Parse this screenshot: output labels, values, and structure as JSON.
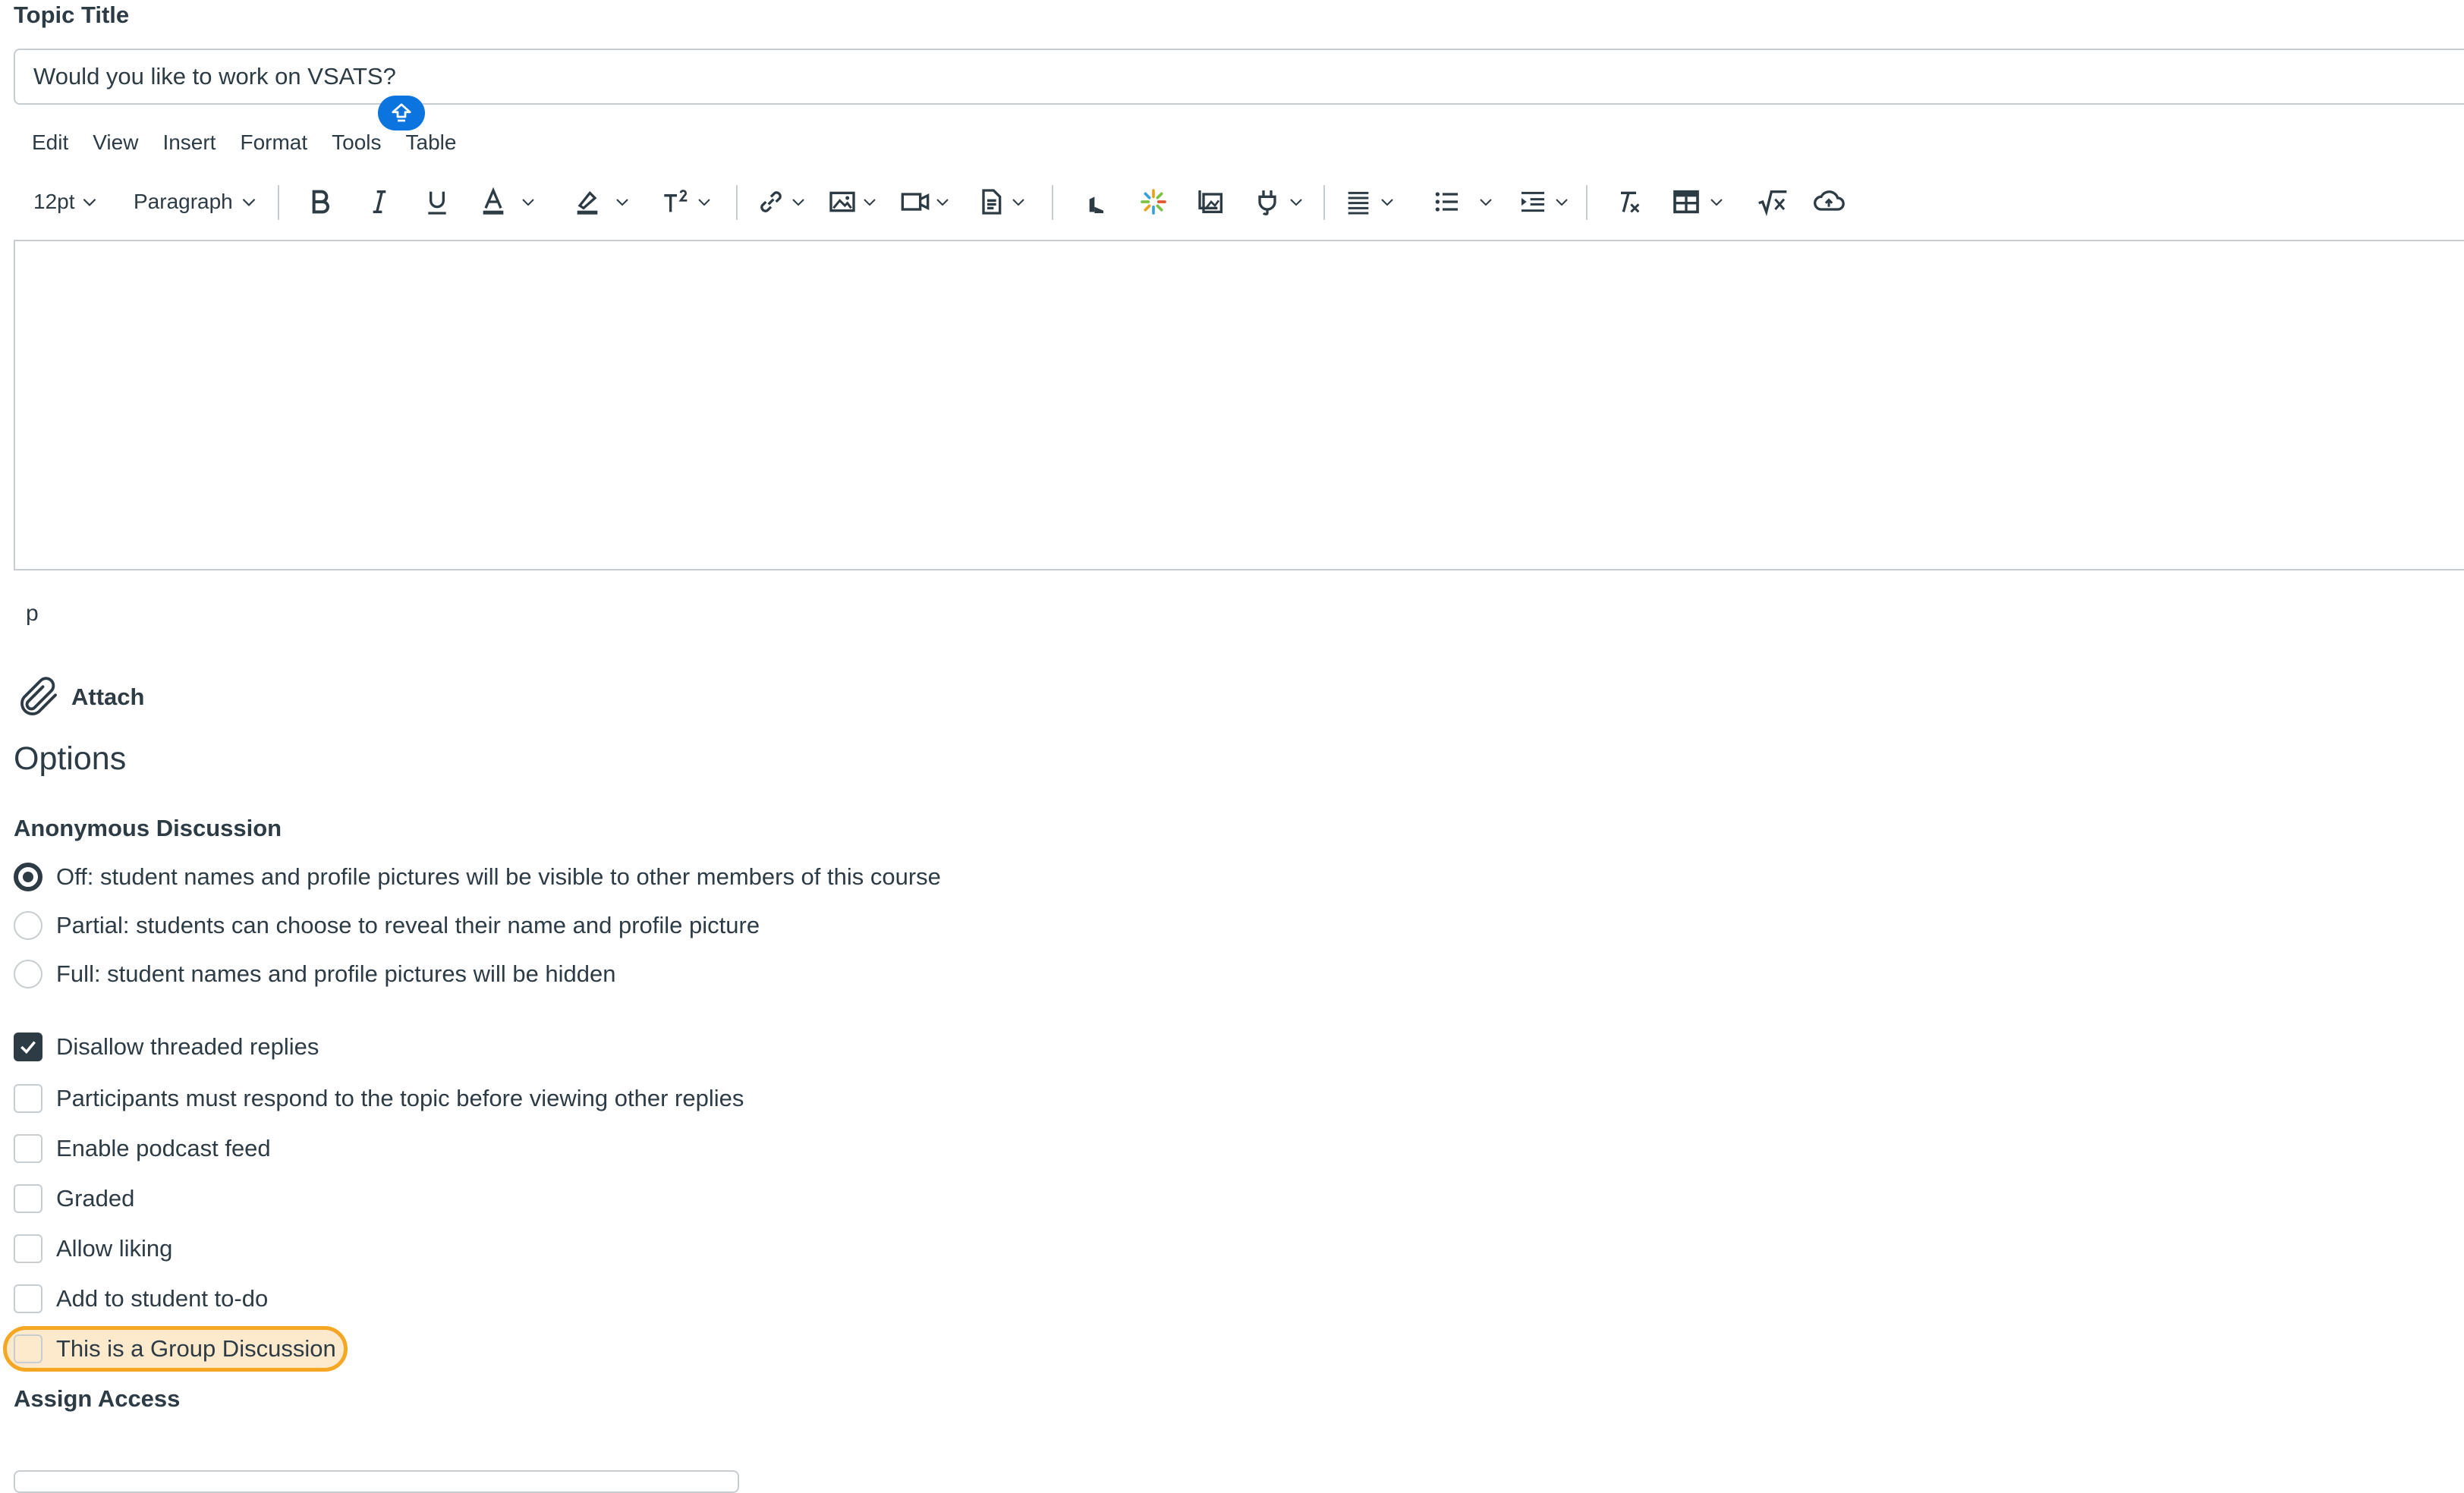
{
  "form": {
    "topic_title_label": "Topic Title",
    "topic_title_value": "Would you like to work on VSATS?"
  },
  "editor": {
    "menu": [
      "Edit",
      "View",
      "Insert",
      "Format",
      "Tools",
      "Table"
    ],
    "font_size": "12pt",
    "block_format": "Paragraph",
    "status_path": "p"
  },
  "attach_label": "Attach",
  "options": {
    "heading": "Options",
    "anonymous": {
      "heading": "Anonymous Discussion",
      "choices": [
        "Off: student names and profile pictures will be visible to other members of this course",
        "Partial: students can choose to reveal their name and profile picture",
        "Full: student names and profile pictures will be hidden"
      ],
      "selected_index": 0
    },
    "checkboxes": [
      {
        "label": "Disallow threaded replies",
        "checked": true
      },
      {
        "label": "Participants must respond to the topic before viewing other replies",
        "checked": false
      },
      {
        "label": "Enable podcast feed",
        "checked": false
      },
      {
        "label": "Graded",
        "checked": false
      },
      {
        "label": "Allow liking",
        "checked": false
      },
      {
        "label": "Add to student to-do",
        "checked": false
      },
      {
        "label": "This is a Group Discussion",
        "checked": false
      }
    ]
  },
  "assign_access_label": "Assign Access",
  "colors": {
    "text": "#2d3b45",
    "border": "#c7cdd1",
    "accent": "#0b74de",
    "focus": "#f5a623"
  }
}
